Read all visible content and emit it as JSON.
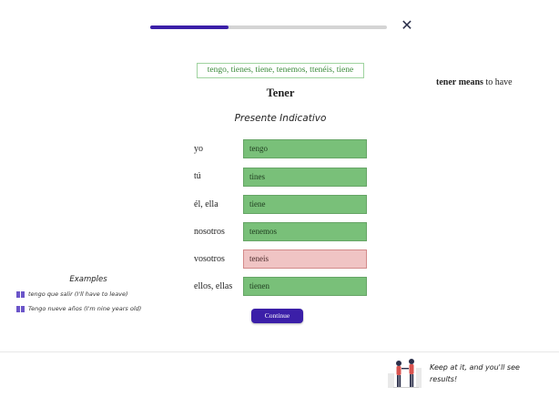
{
  "progress": {
    "value": 0.33
  },
  "close": {
    "icon": "close-icon",
    "label": "✕"
  },
  "answer": {
    "text": "tengo, tienes, tiene, tenemos, ttenéis, tiene"
  },
  "verb": {
    "title": "Tener"
  },
  "tense": {
    "title": "Presente Indicativo"
  },
  "hint": {
    "verb": "tener",
    "means": "means",
    "translation": "to have"
  },
  "conjugations": [
    {
      "pronoun": "yo",
      "value": "tengo",
      "status": "correct"
    },
    {
      "pronoun": "tú",
      "value": "tines",
      "status": "correct"
    },
    {
      "pronoun": "él, ella",
      "value": "tiene",
      "status": "correct"
    },
    {
      "pronoun": "nosotros",
      "value": "tenemos",
      "status": "correct"
    },
    {
      "pronoun": "vosotros",
      "value": "teneis",
      "status": "wrong"
    },
    {
      "pronoun": "ellos, ellas",
      "value": "tienen",
      "status": "correct"
    }
  ],
  "continue": {
    "label": "Continue"
  },
  "examples": {
    "title": "Examples",
    "items": [
      {
        "icon": "book-icon",
        "text": "tengo que salir (I'll have to leave)"
      },
      {
        "icon": "book-icon",
        "text": "Tengo nueve años (I'm nine years old)"
      }
    ]
  },
  "footer": {
    "message": "Keep at it, and you'll see results!"
  },
  "colors": {
    "accent": "#3b1fa8",
    "correct": "#79c079",
    "wrong": "#f0c4c4",
    "answer_text": "#3a8a3a"
  }
}
